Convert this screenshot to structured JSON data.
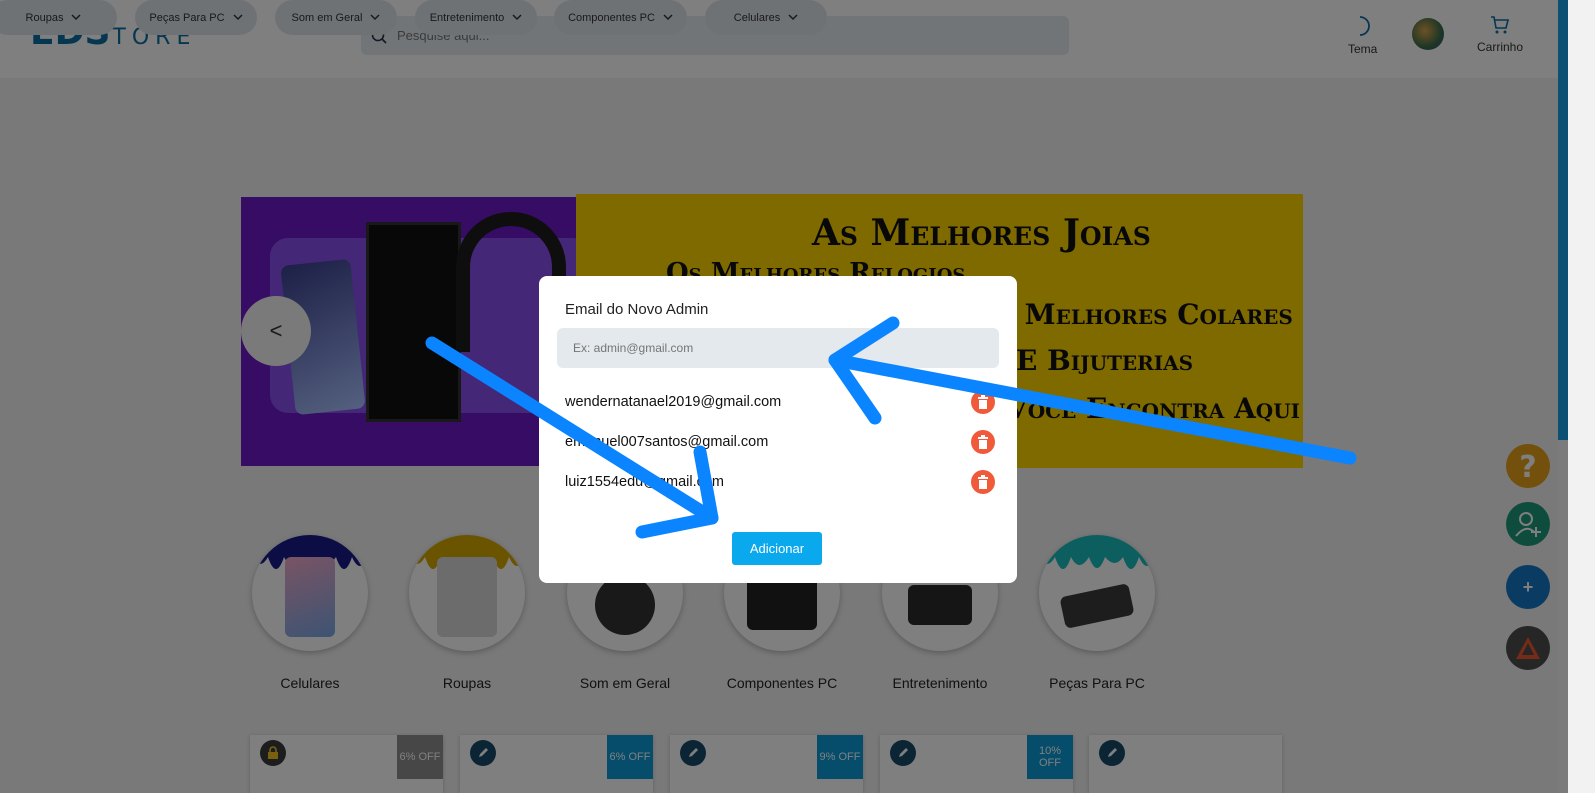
{
  "header": {
    "logo_bold": "EDS",
    "logo_light": "TORE",
    "search_placeholder": "Pesquise aqui...",
    "theme_label": "Tema",
    "cart_label": "Carrinho"
  },
  "category_nav": [
    {
      "label": "Roupas"
    },
    {
      "label": "Peças Para PC"
    },
    {
      "label": "Som em Geral"
    },
    {
      "label": "Entretenimento"
    },
    {
      "label": "Componentes PC"
    },
    {
      "label": "Celulares"
    }
  ],
  "banner": {
    "prev_label": "<",
    "lines": [
      "As Melhores Joias",
      "Os Melhores Relogios",
      "Os Melhores Colares",
      "E Bijuterias",
      "Você Encontra Aqui"
    ]
  },
  "categories": [
    {
      "label": "Celulares",
      "color": "#1a1a8a"
    },
    {
      "label": "Roupas",
      "color": "#d4a800"
    },
    {
      "label": "Som em Geral",
      "color": "#222222"
    },
    {
      "label": "Componentes PC",
      "color": "#b00020"
    },
    {
      "label": "Entretenimento",
      "color": "#1a3a8a"
    },
    {
      "label": "Peças Para PC",
      "color": "#1abfbf"
    }
  ],
  "product_cards": [
    {
      "discount": "6% OFF",
      "icon": "lock-icon"
    },
    {
      "discount": "6% OFF",
      "icon": "pencil-icon"
    },
    {
      "discount": "9% OFF",
      "icon": "pencil-icon"
    },
    {
      "discount": "10% OFF",
      "icon": "pencil-icon"
    },
    {
      "discount": "",
      "icon": "pencil-icon"
    }
  ],
  "fabs": [
    {
      "icon": "question-icon",
      "color": "#e6a21a"
    },
    {
      "icon": "add-user-icon",
      "color": "#1d9b7c"
    },
    {
      "icon": "plus-icon",
      "color": "#1479c6",
      "label": "+"
    },
    {
      "icon": "warning-icon",
      "color": "#4d4d4d"
    }
  ],
  "modal": {
    "title": "Email do Novo Admin",
    "input_placeholder": "Ex: admin@gmail.com",
    "admins": [
      "wendernatanael2019@gmail.com",
      "emanuel007santos@gmail.com",
      "luiz1554edu@gmail.com"
    ],
    "add_button": "Adicionar"
  },
  "colors": {
    "accent": "#0aa9ee",
    "brand": "#0d6fa0",
    "delete": "#f05a3a",
    "annotation_arrow": "#0a84ff"
  }
}
